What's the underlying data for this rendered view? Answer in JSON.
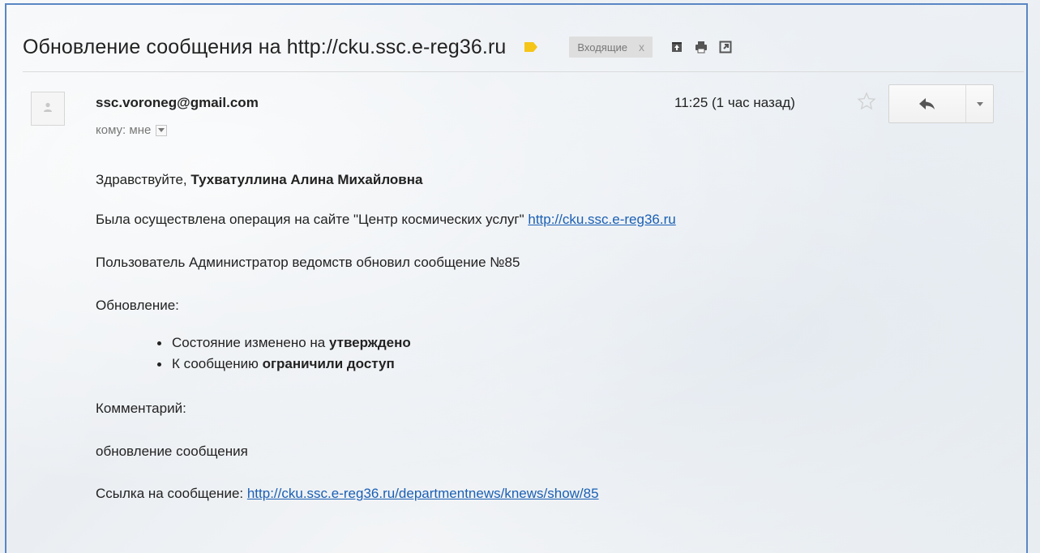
{
  "email": {
    "subject": "Обновление сообщения на http://cku.ssc.e-reg36.ru",
    "label_chip": "Входящие",
    "label_chip_close": "x",
    "sender": "ssc.voroneg@gmail.com",
    "to_line": "кому: мне",
    "time": "11:25 (1 час назад)",
    "greeting_prefix": "Здравствуйте, ",
    "greeting_name": "Тухватуллина Алина Михайловна",
    "line1_text": "Была осуществлена операция на сайте \"Центр космических услуг\" ",
    "line1_link": "http://cku.ssc.e-reg36.ru",
    "line2": "Пользователь Администратор ведомств обновил сообщение №85",
    "updates_heading": "Обновление:",
    "updates": [
      {
        "prefix": "Состояние изменено на ",
        "bold": "утверждено"
      },
      {
        "prefix": "К сообщению ",
        "bold": "ограничили доступ"
      }
    ],
    "comment_heading": "Комментарий:",
    "comment_text": "обновление сообщения",
    "link_prefix": "Ссылка на сообщение: ",
    "link_url": "http://cku.ssc.e-reg36.ru/departmentnews/knews/show/85"
  },
  "icons": {
    "label": "label-tag-icon",
    "archive": "archive-icon",
    "print": "print-icon",
    "new_window": "new-window-icon",
    "avatar": "person-icon",
    "to_dropdown": "chevron-down-icon",
    "star": "star-icon",
    "reply": "reply-icon",
    "more": "chevron-down-icon"
  },
  "colors": {
    "link": "#1a5fb4",
    "label_tag": "#f5c518",
    "frame_border": "#5a86c4"
  }
}
